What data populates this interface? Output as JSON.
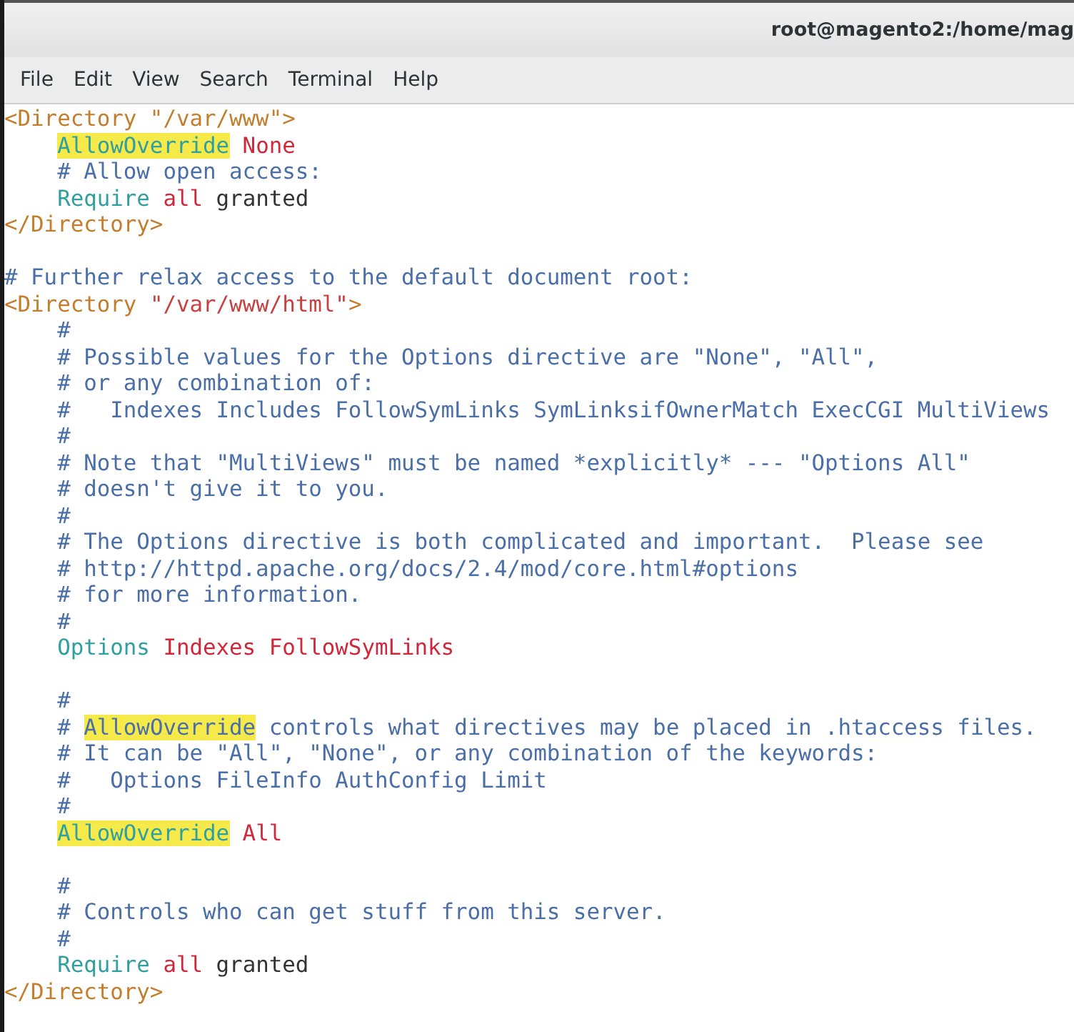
{
  "window": {
    "title": "root@magento2:/home/mag"
  },
  "menu": [
    {
      "label": "File"
    },
    {
      "label": "Edit"
    },
    {
      "label": "View"
    },
    {
      "label": "Search"
    },
    {
      "label": "Terminal"
    },
    {
      "label": "Help"
    }
  ],
  "lines": [
    {
      "kind": "code",
      "segments": [
        {
          "kind": "tag",
          "text": "<Directory \"/var/www\">",
          "highlighted": false
        }
      ],
      "children": [
        {
          "kind": "code",
          "segments": [
            {
              "kind": "directive",
              "text": "AllowOverride",
              "highlighted": true
            },
            {
              "kind": "value",
              "text": " None",
              "highlighted": false
            }
          ]
        },
        {
          "kind": "code",
          "segments": [
            {
              "kind": "comment",
              "text": "# Allow open access:",
              "highlighted": false
            }
          ]
        },
        {
          "kind": "code",
          "segments": [
            {
              "kind": "directive",
              "text": "Require",
              "highlighted": false
            },
            {
              "kind": "value",
              "text": " all",
              "highlighted": false
            },
            {
              "kind": "plain",
              "text": " granted",
              "highlighted": false
            }
          ]
        }
      ]
    },
    {
      "kind": "code",
      "segments": [
        {
          "kind": "tag",
          "text": "</Directory>",
          "highlighted": false
        }
      ]
    },
    {
      "kind": "blank"
    },
    {
      "kind": "code",
      "segments": [
        {
          "kind": "comment",
          "text": "# Further relax access to the default document root:",
          "highlighted": false
        }
      ]
    },
    {
      "kind": "code",
      "segments": [
        {
          "kind": "tag",
          "text": "<Directory ",
          "highlighted": false
        },
        {
          "kind": "string",
          "text": "\"/var/www/html\"",
          "highlighted": false
        },
        {
          "kind": "tag",
          "text": ">",
          "highlighted": false
        }
      ],
      "children": [
        {
          "kind": "code",
          "segments": [
            {
              "kind": "comment",
              "text": "#",
              "highlighted": false
            }
          ]
        },
        {
          "kind": "code",
          "segments": [
            {
              "kind": "comment",
              "text": "# Possible values for the Options directive are \"None\", \"All\",",
              "highlighted": false
            }
          ]
        },
        {
          "kind": "code",
          "segments": [
            {
              "kind": "comment",
              "text": "# or any combination of:",
              "highlighted": false
            }
          ]
        },
        {
          "kind": "code",
          "segments": [
            {
              "kind": "comment",
              "text": "#   Indexes Includes FollowSymLinks SymLinksifOwnerMatch ExecCGI MultiViews",
              "highlighted": false
            }
          ]
        },
        {
          "kind": "code",
          "segments": [
            {
              "kind": "comment",
              "text": "#",
              "highlighted": false
            }
          ]
        },
        {
          "kind": "code",
          "segments": [
            {
              "kind": "comment",
              "text": "# Note that \"MultiViews\" must be named *explicitly* --- \"Options All\"",
              "highlighted": false
            }
          ]
        },
        {
          "kind": "code",
          "segments": [
            {
              "kind": "comment",
              "text": "# doesn't give it to you.",
              "highlighted": false
            }
          ]
        },
        {
          "kind": "code",
          "segments": [
            {
              "kind": "comment",
              "text": "#",
              "highlighted": false
            }
          ]
        },
        {
          "kind": "code",
          "segments": [
            {
              "kind": "comment",
              "text": "# The Options directive is both complicated and important.  Please see",
              "highlighted": false
            }
          ]
        },
        {
          "kind": "code",
          "segments": [
            {
              "kind": "comment",
              "text": "# http://httpd.apache.org/docs/2.4/mod/core.html#options",
              "highlighted": false
            }
          ]
        },
        {
          "kind": "code",
          "segments": [
            {
              "kind": "comment",
              "text": "# for more information.",
              "highlighted": false
            }
          ]
        },
        {
          "kind": "code",
          "segments": [
            {
              "kind": "comment",
              "text": "#",
              "highlighted": false
            }
          ]
        },
        {
          "kind": "code",
          "segments": [
            {
              "kind": "directive",
              "text": "Options",
              "highlighted": false
            },
            {
              "kind": "value",
              "text": " Indexes FollowSymLinks",
              "highlighted": false
            }
          ]
        },
        {
          "kind": "blank"
        },
        {
          "kind": "code",
          "segments": [
            {
              "kind": "comment",
              "text": "#",
              "highlighted": false
            }
          ]
        },
        {
          "kind": "code",
          "segments": [
            {
              "kind": "comment",
              "text": "# ",
              "highlighted": false
            },
            {
              "kind": "comment",
              "text": "AllowOverride",
              "highlighted": true
            },
            {
              "kind": "comment",
              "text": " controls what directives may be placed in .htaccess files.",
              "highlighted": false
            }
          ]
        },
        {
          "kind": "code",
          "segments": [
            {
              "kind": "comment",
              "text": "# It can be \"All\", \"None\", or any combination of the keywords:",
              "highlighted": false
            }
          ]
        },
        {
          "kind": "code",
          "segments": [
            {
              "kind": "comment",
              "text": "#   Options FileInfo AuthConfig Limit",
              "highlighted": false
            }
          ]
        },
        {
          "kind": "code",
          "segments": [
            {
              "kind": "comment",
              "text": "#",
              "highlighted": false
            }
          ]
        },
        {
          "kind": "code",
          "segments": [
            {
              "kind": "directive",
              "text": "AllowOverride",
              "highlighted": true
            },
            {
              "kind": "value",
              "text": " All",
              "highlighted": false
            }
          ]
        },
        {
          "kind": "blank"
        },
        {
          "kind": "code",
          "segments": [
            {
              "kind": "comment",
              "text": "#",
              "highlighted": false
            }
          ]
        },
        {
          "kind": "code",
          "segments": [
            {
              "kind": "comment",
              "text": "# Controls who can get stuff from this server.",
              "highlighted": false
            }
          ]
        },
        {
          "kind": "code",
          "segments": [
            {
              "kind": "comment",
              "text": "#",
              "highlighted": false
            }
          ]
        },
        {
          "kind": "code",
          "segments": [
            {
              "kind": "directive",
              "text": "Require",
              "highlighted": false
            },
            {
              "kind": "value",
              "text": " all",
              "highlighted": false
            },
            {
              "kind": "plain",
              "text": " granted",
              "highlighted": false
            }
          ]
        }
      ]
    },
    {
      "kind": "code",
      "segments": [
        {
          "kind": "tag",
          "text": "</Directory>",
          "highlighted": false
        }
      ]
    }
  ]
}
